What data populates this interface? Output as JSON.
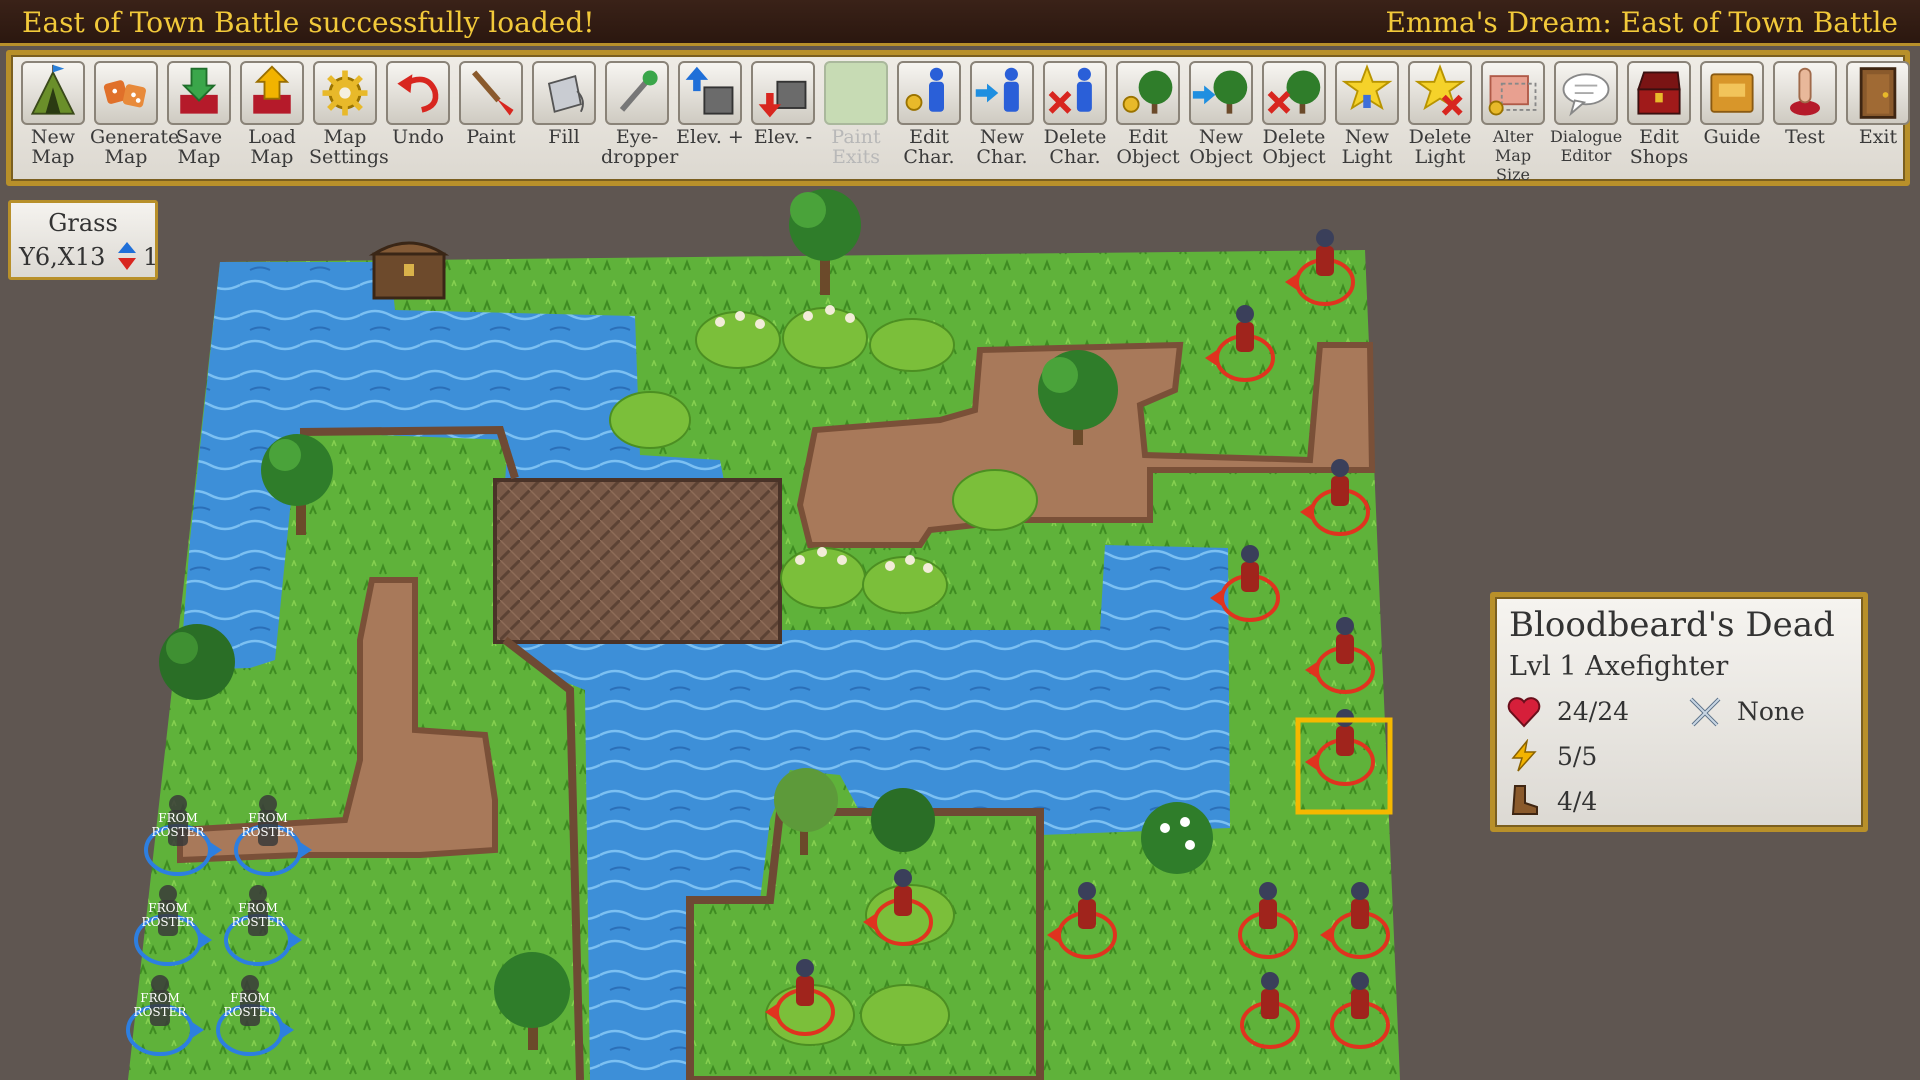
{
  "titlebar": {
    "status": "East of Town Battle successfully loaded!",
    "map_name": "Emma's Dream: East of Town Battle"
  },
  "toolbar": {
    "tools": [
      {
        "id": "new-map",
        "label": "New\nMap",
        "icon": "tent-icon"
      },
      {
        "id": "generate-map",
        "label": "Generate\nMap",
        "icon": "dice-icon"
      },
      {
        "id": "save-map",
        "label": "Save\nMap",
        "icon": "save-icon"
      },
      {
        "id": "load-map",
        "label": "Load\nMap",
        "icon": "load-icon"
      },
      {
        "id": "map-settings",
        "label": "Map\nSettings",
        "icon": "gear-icon"
      },
      {
        "id": "undo",
        "label": "Undo",
        "icon": "undo-icon"
      },
      {
        "id": "paint",
        "label": "Paint",
        "icon": "brush-icon"
      },
      {
        "id": "fill",
        "label": "Fill",
        "icon": "bucket-icon"
      },
      {
        "id": "eyedropper",
        "label": "Eye-\ndropper",
        "icon": "eyedropper-icon"
      },
      {
        "id": "elev-up",
        "label": "Elev. +",
        "icon": "elevation-up-icon"
      },
      {
        "id": "elev-down",
        "label": "Elev. -",
        "icon": "elevation-down-icon"
      },
      {
        "id": "paint-exits",
        "label": "Paint\nExits",
        "icon": "exit-paint-icon",
        "disabled": true
      },
      {
        "id": "edit-char",
        "label": "Edit\nChar.",
        "icon": "edit-character-icon"
      },
      {
        "id": "new-char",
        "label": "New\nChar.",
        "icon": "new-character-icon"
      },
      {
        "id": "delete-char",
        "label": "Delete\nChar.",
        "icon": "delete-character-icon"
      },
      {
        "id": "edit-object",
        "label": "Edit\nObject",
        "icon": "edit-object-icon"
      },
      {
        "id": "new-object",
        "label": "New\nObject",
        "icon": "new-object-icon"
      },
      {
        "id": "delete-object",
        "label": "Delete\nObject",
        "icon": "delete-object-icon"
      },
      {
        "id": "new-light",
        "label": "New\nLight",
        "icon": "new-light-icon"
      },
      {
        "id": "delete-light",
        "label": "Delete\nLight",
        "icon": "delete-light-icon"
      },
      {
        "id": "alter-map-size",
        "label": "Alter\nMap Size",
        "icon": "map-size-icon",
        "small": true
      },
      {
        "id": "dialogue-editor",
        "label": "Dialogue\nEditor",
        "icon": "speech-bubble-icon",
        "small": true
      },
      {
        "id": "edit-shops",
        "label": "Edit\nShops",
        "icon": "chest-icon"
      },
      {
        "id": "guide",
        "label": "Guide",
        "icon": "book-icon"
      },
      {
        "id": "test",
        "label": "Test",
        "icon": "finger-button-icon"
      },
      {
        "id": "exit",
        "label": "Exit",
        "icon": "door-icon"
      }
    ]
  },
  "tile_info": {
    "terrain": "Grass",
    "coords": "Y6,X13",
    "elevation": "1"
  },
  "roster_label": "FROM\nROSTER",
  "character": {
    "name": "Bloodbeard's Dead",
    "class_line": "Lvl 1 Axefighter",
    "hp": "24/24",
    "weapon": "None",
    "energy": "5/5",
    "move": "4/4"
  },
  "colors": {
    "accent_gold": "#b8902a",
    "title_text": "#f2c93a",
    "grass": "#5fb23a",
    "water": "#3f8fd6",
    "dirt": "#a8795a",
    "enemy_ring": "#e0331f",
    "ally_ring": "#2d7fe0",
    "selection": "#f5b800"
  }
}
